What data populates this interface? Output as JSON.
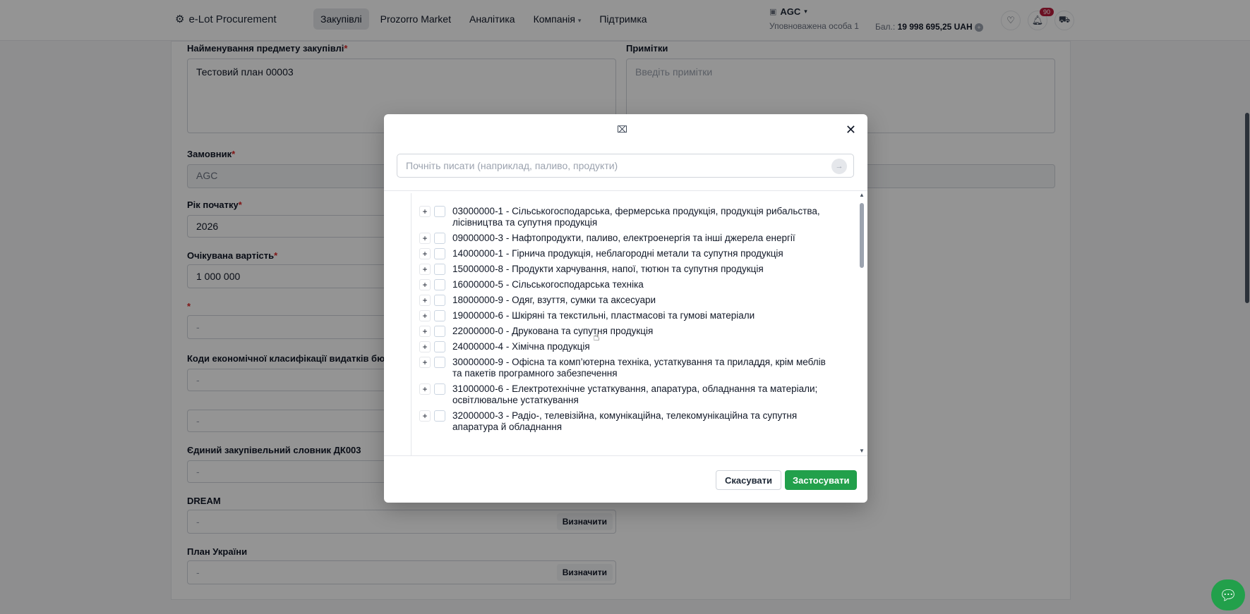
{
  "header": {
    "logo_text": "e-Lot Procurement",
    "nav": [
      "Закупівлі",
      "Prozorro Market",
      "Аналітика",
      "Компанія",
      "Підтримка"
    ],
    "org_name": "AGC",
    "org_sub": "Уповноважена особа 1",
    "balance_label": "Бал.:",
    "balance_value": "19 998 695,25 UAH",
    "notifications_count": "90"
  },
  "form": {
    "subject_label": "Найменування предмету закупівлі",
    "subject_value": "Тестовий план 00003",
    "notes_label": "Примітки",
    "notes_placeholder": "Введіть примітки",
    "customer_label": "Замовник",
    "customer_value": "AGC",
    "year_label": "Рік початку",
    "year_value": "2026",
    "expected_label": "Очікувана вартість",
    "expected_value": "1 000 000",
    "unnamed_label": "*",
    "dash": "-",
    "econ_label": "Коди економічної класифікації видатків бюдж",
    "dk_label": "Єдиний закупівельний словник ДК003",
    "dream_label": "DREAM",
    "plan_label": "План України",
    "define_button": "Визначити",
    "req_mark": "*"
  },
  "modal": {
    "title_icon": "⌧",
    "close": "✕",
    "search_placeholder": "Почніть писати (наприклад, паливо, продукти)",
    "items": [
      "03000000-1 - Сільськогосподарська, фермерська продукція, продукція рибальства, лісівництва та супутня продукція",
      "09000000-3 - Нафтопродукти, паливо, електроенергія та інші джерела енергії",
      "14000000-1 - Гірнича продукція, неблагородні метали та супутня продукція",
      "15000000-8 - Продукти харчування, напої, тютюн та супутня продукція",
      "16000000-5 - Сільськогосподарська техніка",
      "18000000-9 - Одяг, взуття, сумки та аксесуари",
      "19000000-6 - Шкіряні та текстильні, пластмасові та гумові матеріали",
      "22000000-0 - Друкована та супутня продукція",
      "24000000-4 - Хімічна продукція",
      "30000000-9 - Офісна та комп’ютерна техніка, устаткування та приладдя, крім меблів та пакетів програмного забезпечення",
      "31000000-6 - Електротехнічне устаткування, апаратура, обладнання та матеріали; освітлювальне устаткування",
      "32000000-3 - Радіо-, телевізійна, комунікаційна, телекомунікаційна та супутня апаратура й обладнання"
    ],
    "cancel": "Скасувати",
    "apply": "Застосувати"
  },
  "colors": {
    "accent": "#22a04b",
    "badge": "#b91c3c"
  }
}
